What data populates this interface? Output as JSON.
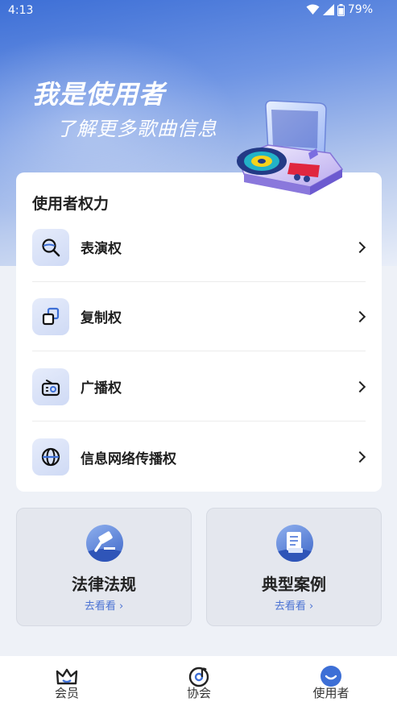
{
  "status_bar": {
    "time": "4:13",
    "battery": "79%"
  },
  "hero": {
    "title": "我是使用者",
    "subtitle": "了解更多歌曲信息"
  },
  "rights_section": {
    "title": "使用者权力",
    "items": [
      {
        "label": "表演权",
        "icon": "magnifier-icon"
      },
      {
        "label": "复制权",
        "icon": "copy-icon"
      },
      {
        "label": "广播权",
        "icon": "radio-icon"
      },
      {
        "label": "信息网络传播权",
        "icon": "globe-icon"
      }
    ]
  },
  "tiles": [
    {
      "title": "法律法规",
      "link": "去看看 ›",
      "icon": "gavel-icon"
    },
    {
      "title": "典型案例",
      "link": "去看看 ›",
      "icon": "case-file-icon"
    }
  ],
  "tabbar": {
    "items": [
      {
        "label": "会员",
        "icon": "crown-icon",
        "active": false
      },
      {
        "label": "协会",
        "icon": "music-disc-icon",
        "active": false
      },
      {
        "label": "使用者",
        "icon": "user-face-icon",
        "active": true
      }
    ]
  },
  "colors": {
    "primary": "#3d6fd6",
    "accent_link": "#4a72d3",
    "card": "#ffffff",
    "background": "#eef1f7"
  }
}
